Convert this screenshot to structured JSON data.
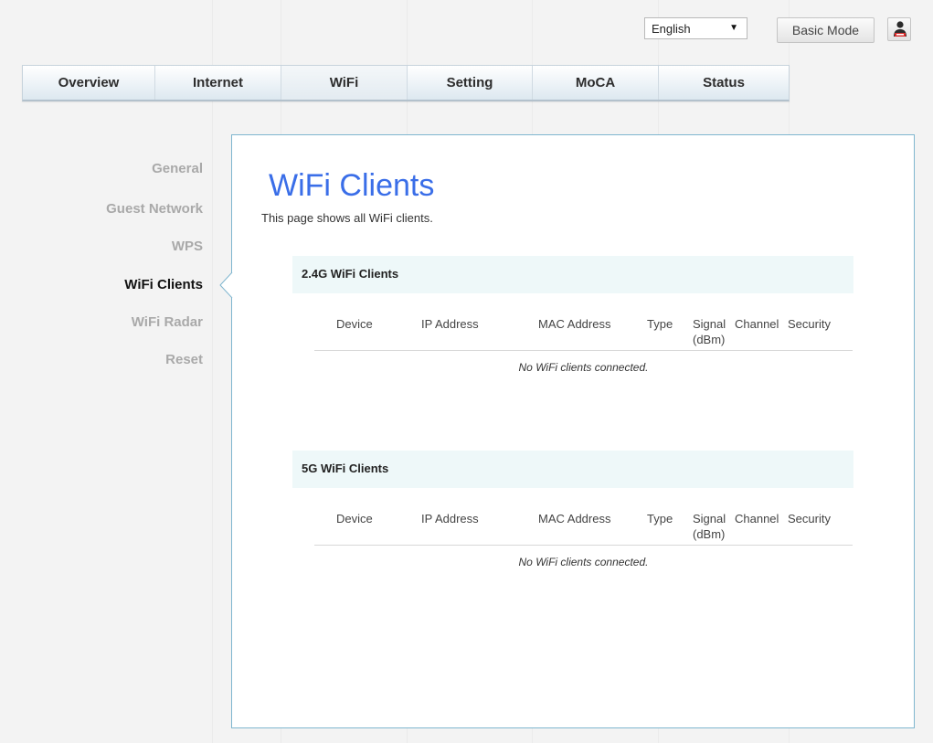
{
  "header": {
    "language": "English",
    "basic_mode_label": "Basic Mode",
    "user_icon": "user-icon"
  },
  "nav": {
    "tabs": [
      {
        "label": "Overview"
      },
      {
        "label": "Internet"
      },
      {
        "label": "WiFi",
        "active": true
      },
      {
        "label": "Setting"
      },
      {
        "label": "MoCA"
      },
      {
        "label": "Status"
      }
    ]
  },
  "sidebar": {
    "items": [
      {
        "label": "General"
      },
      {
        "label": "Guest Network"
      },
      {
        "label": "WPS"
      },
      {
        "label": "WiFi Clients",
        "active": true
      },
      {
        "label": "WiFi Radar"
      },
      {
        "label": "Reset"
      }
    ]
  },
  "main": {
    "title": "WiFi Clients",
    "description": "This page shows all WiFi clients.",
    "columns": [
      "Device",
      "IP Address",
      "MAC Address",
      "Type",
      "Signal (dBm)",
      "Channel",
      "Security"
    ],
    "sections": [
      {
        "title": "2.4G WiFi Clients",
        "empty_message": "No WiFi clients connected."
      },
      {
        "title": "5G WiFi Clients",
        "empty_message": "No WiFi clients connected."
      }
    ]
  },
  "colors": {
    "accent_title": "#3a6ee8",
    "panel_border": "#7fb6cf",
    "section_header_bg": "#eef8f9"
  }
}
